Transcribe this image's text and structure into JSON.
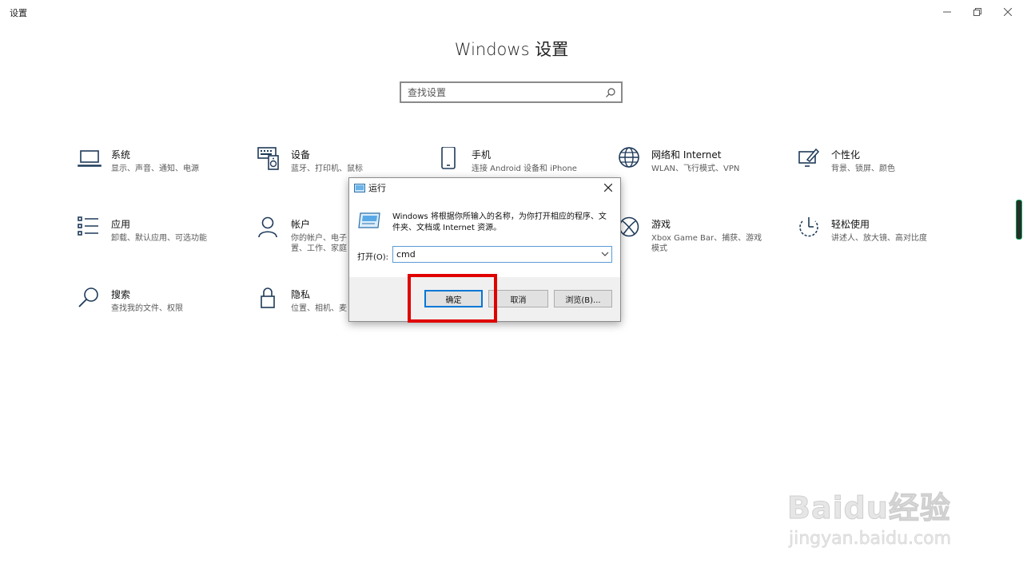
{
  "window": {
    "title": "设置"
  },
  "page": {
    "title": "Windows 设置"
  },
  "search": {
    "placeholder": "查找设置"
  },
  "tiles": [
    {
      "name": "系统",
      "desc": "显示、声音、通知、电源"
    },
    {
      "name": "设备",
      "desc": "蓝牙、打印机、鼠标"
    },
    {
      "name": "手机",
      "desc": "连接 Android 设备和 iPhone"
    },
    {
      "name": "网络和 Internet",
      "desc": "WLAN、飞行模式、VPN"
    },
    {
      "name": "个性化",
      "desc": "背景、锁屏、颜色"
    },
    {
      "name": "应用",
      "desc": "卸载、默认应用、可选功能"
    },
    {
      "name": "帐户",
      "desc": "你的帐户、电子\n置、工作、家庭"
    },
    {
      "name": "游戏",
      "desc": "Xbox Game Bar、捕获、游戏\n模式"
    },
    {
      "name": "轻松使用",
      "desc": "讲述人、放大镜、高对比度"
    },
    {
      "name": "搜索",
      "desc": "查找我的文件、权限"
    },
    {
      "name": "隐私",
      "desc": "位置、相机、麦"
    }
  ],
  "run_dialog": {
    "title": "运行",
    "description": "Windows 将根据你所输入的名称，为你打开相应的程序、文件夹、文档或 Internet 资源。",
    "open_label": "打开(O):",
    "open_value": "cmd",
    "ok_label": "确定",
    "cancel_label": "取消",
    "browse_label": "浏览(B)..."
  },
  "watermark": {
    "logo": "Baidu经验",
    "url": "jingyan.baidu.com"
  },
  "colors": {
    "highlight": "#e00000",
    "accent": "#0078d7",
    "icon": "#1f3a5a"
  }
}
